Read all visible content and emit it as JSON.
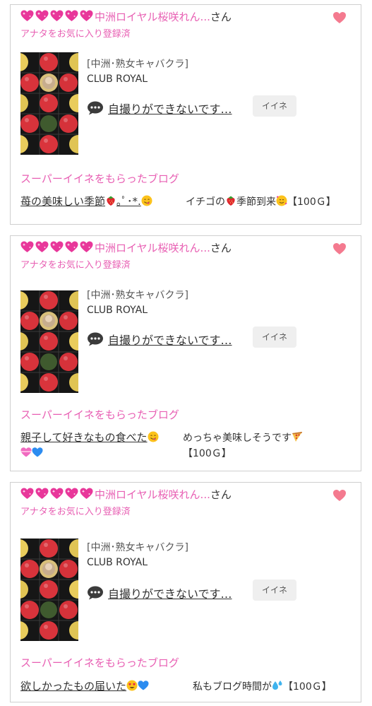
{
  "cards": [
    {
      "sender_name": "中洲ロイヤル桜咲れん...",
      "san_suffix": "さん",
      "fav_status": "アナタをお気に入り登録済",
      "category": "[中洲･熟女キャバクラ]",
      "shop_name": "CLUB ROYAL",
      "blog_title": "自撮りができないです…",
      "iine_label": "イイネ",
      "section_label": "スーパーイイネをもらったブログ",
      "super_blog_title_a": "苺の美味しい季節",
      "super_blog_title_b": "｡ﾟ･*.",
      "super_comment_a": "イチゴの",
      "super_comment_b": "季節到来",
      "super_comment_c": "【100Ｇ】"
    },
    {
      "sender_name": "中洲ロイヤル桜咲れん...",
      "san_suffix": "さん",
      "fav_status": "アナタをお気に入り登録済",
      "category": "[中洲･熟女キャバクラ]",
      "shop_name": "CLUB ROYAL",
      "blog_title": "自撮りができないです…",
      "iine_label": "イイネ",
      "section_label": "スーパーイイネをもらったブログ",
      "super_blog_title_a": "親子して好きなもの食べた",
      "super_comment_a": "めっちゃ美味しそうです",
      "super_comment_c": "【100Ｇ】"
    },
    {
      "sender_name": "中洲ロイヤル桜咲れん...",
      "san_suffix": "さん",
      "fav_status": "アナタをお気に入り登録済",
      "category": "[中洲･熟女キャバクラ]",
      "shop_name": "CLUB ROYAL",
      "blog_title": "自撮りができないです…",
      "iine_label": "イイネ",
      "section_label": "スーパーイイネをもらったブログ",
      "super_blog_title_a": "欲しかったもの届いた",
      "super_comment_a": "私もブログ時間が",
      "super_comment_c": "【100Ｇ】"
    }
  ],
  "icons": {
    "sparkle_heart": "sparkling-heart-icon",
    "favorite": "heart-icon",
    "comment": "speech-balloon-icon",
    "strawberry": "strawberry-icon",
    "smile": "yum-face-icon",
    "hearts_face": "smiling-face-with-hearts-icon",
    "pizza": "pizza-icon",
    "pink_heart": "heart-with-ribbon-icon",
    "blue_heart": "blue-heart-icon",
    "heart_eyes": "heart-eyes-icon",
    "sweat": "sweat-droplets-icon"
  },
  "colors": {
    "accent_pink": "#e85fb3",
    "favorite_heart": "#f47a8f",
    "card_border": "#cfcfcf",
    "button_bg": "#efefef"
  }
}
